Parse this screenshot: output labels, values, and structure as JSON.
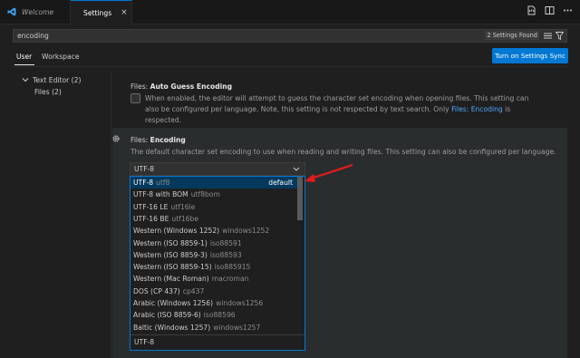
{
  "tabs": {
    "welcome": "Welcome",
    "settings": "Settings",
    "close_glyph": "×"
  },
  "search": {
    "value": "encoding",
    "count": "2 Settings Found"
  },
  "scope": {
    "user": "User",
    "workspace": "Workspace",
    "sync_button": "Turn on Settings Sync"
  },
  "tree": {
    "text_editor": "Text Editor (2)",
    "files": "Files (2)"
  },
  "settings": [
    {
      "category": "Files: ",
      "name": "Auto Guess Encoding",
      "desc_before": "When enabled, the editor will attempt to guess the character set encoding when opening files. This setting can also be configured per language. Note, this setting is not respected by text search. Only ",
      "link": "Files: Encoding",
      "desc_after": " is respected."
    },
    {
      "category": "Files: ",
      "name": "Encoding",
      "desc": "The default character set encoding to use when reading and writing files. This setting can also be configured per language.",
      "value": "UTF-8"
    }
  ],
  "dropdown": {
    "options": [
      {
        "label": "UTF-8",
        "enc": "utf8",
        "tag": "default"
      },
      {
        "label": "UTF-8 with BOM",
        "enc": "utf8bom",
        "tag": ""
      },
      {
        "label": "UTF-16 LE",
        "enc": "utf16le",
        "tag": ""
      },
      {
        "label": "UTF-16 BE",
        "enc": "utf16be",
        "tag": ""
      },
      {
        "label": "Western (Windows 1252)",
        "enc": "windows1252",
        "tag": ""
      },
      {
        "label": "Western (ISO 8859-1)",
        "enc": "iso88591",
        "tag": ""
      },
      {
        "label": "Western (ISO 8859-3)",
        "enc": "iso88593",
        "tag": ""
      },
      {
        "label": "Western (ISO 8859-15)",
        "enc": "iso885915",
        "tag": ""
      },
      {
        "label": "Western (Mac Roman)",
        "enc": "macroman",
        "tag": ""
      },
      {
        "label": "DOS (CP 437)",
        "enc": "cp437",
        "tag": ""
      },
      {
        "label": "Arabic (Windows 1256)",
        "enc": "windows1256",
        "tag": ""
      },
      {
        "label": "Arabic (ISO 8859-6)",
        "enc": "iso88596",
        "tag": ""
      },
      {
        "label": "Baltic (Windows 1257)",
        "enc": "windows1257",
        "tag": ""
      }
    ],
    "footer": "UTF-8",
    "selected_index": 0
  },
  "icons": {
    "vscode": "vscode-logo-icon",
    "settings_tab": "settings-file-icon",
    "split": "split-editor-icon",
    "open_json": "open-settings-json-icon",
    "more": "more-actions-icon",
    "clear_filter": "clear-filter-icon",
    "filter": "filter-icon",
    "gear": "gear-icon",
    "chevron": "chevron-down-icon",
    "arrow": "red-annotation-arrow"
  },
  "colors": {
    "accent": "#0078d4",
    "link": "#4daafc",
    "annotation": "#e51a1a"
  }
}
